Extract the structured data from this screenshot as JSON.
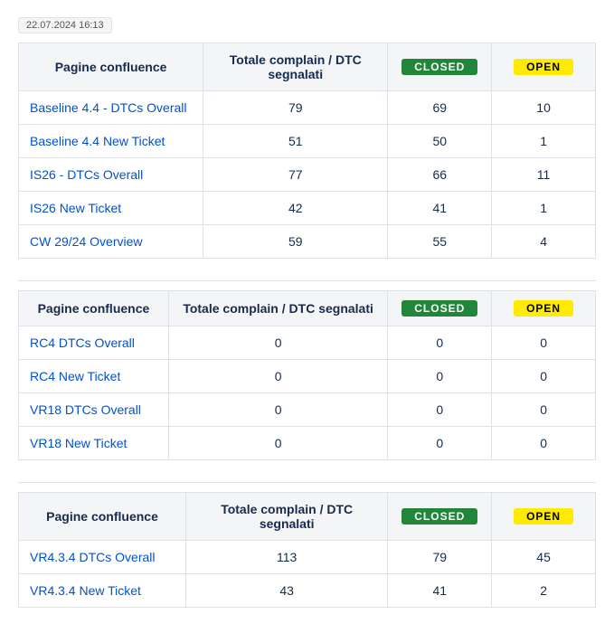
{
  "timestamp": "22.07.2024 16:13",
  "headers": {
    "col1": "Pagine confluence",
    "col2": "Totale complain / DTC segnalati",
    "closed": "CLOSED",
    "open": "OPEN"
  },
  "tables": [
    {
      "col1_width": "32%",
      "rows": [
        {
          "label": "Baseline 4.4 - DTCs Overall",
          "total": "79",
          "closed": "69",
          "open": "10"
        },
        {
          "label": "Baseline 4.4 New Ticket",
          "total": "51",
          "closed": "50",
          "open": "1"
        },
        {
          "label": "IS26 - DTCs Overall",
          "total": "77",
          "closed": "66",
          "open": "11"
        },
        {
          "label": "IS26 New Ticket",
          "total": "42",
          "closed": "41",
          "open": "1"
        },
        {
          "label": "CW 29/24 Overview",
          "total": "59",
          "closed": "55",
          "open": "4"
        }
      ]
    },
    {
      "col1_width": "26%",
      "rows": [
        {
          "label": "RC4 DTCs Overall",
          "total": "0",
          "closed": "0",
          "open": "0"
        },
        {
          "label": "RC4 New Ticket",
          "total": "0",
          "closed": "0",
          "open": "0"
        },
        {
          "label": "VR18 DTCs Overall",
          "total": "0",
          "closed": "0",
          "open": "0"
        },
        {
          "label": "VR18 New Ticket",
          "total": "0",
          "closed": "0",
          "open": "0"
        }
      ]
    },
    {
      "col1_width": "29%",
      "rows": [
        {
          "label": "VR4.3.4 DTCs Overall",
          "total": "113",
          "closed": "79",
          "open": "45"
        },
        {
          "label": "VR4.3.4 New Ticket",
          "total": "43",
          "closed": "41",
          "open": "2"
        }
      ]
    }
  ]
}
